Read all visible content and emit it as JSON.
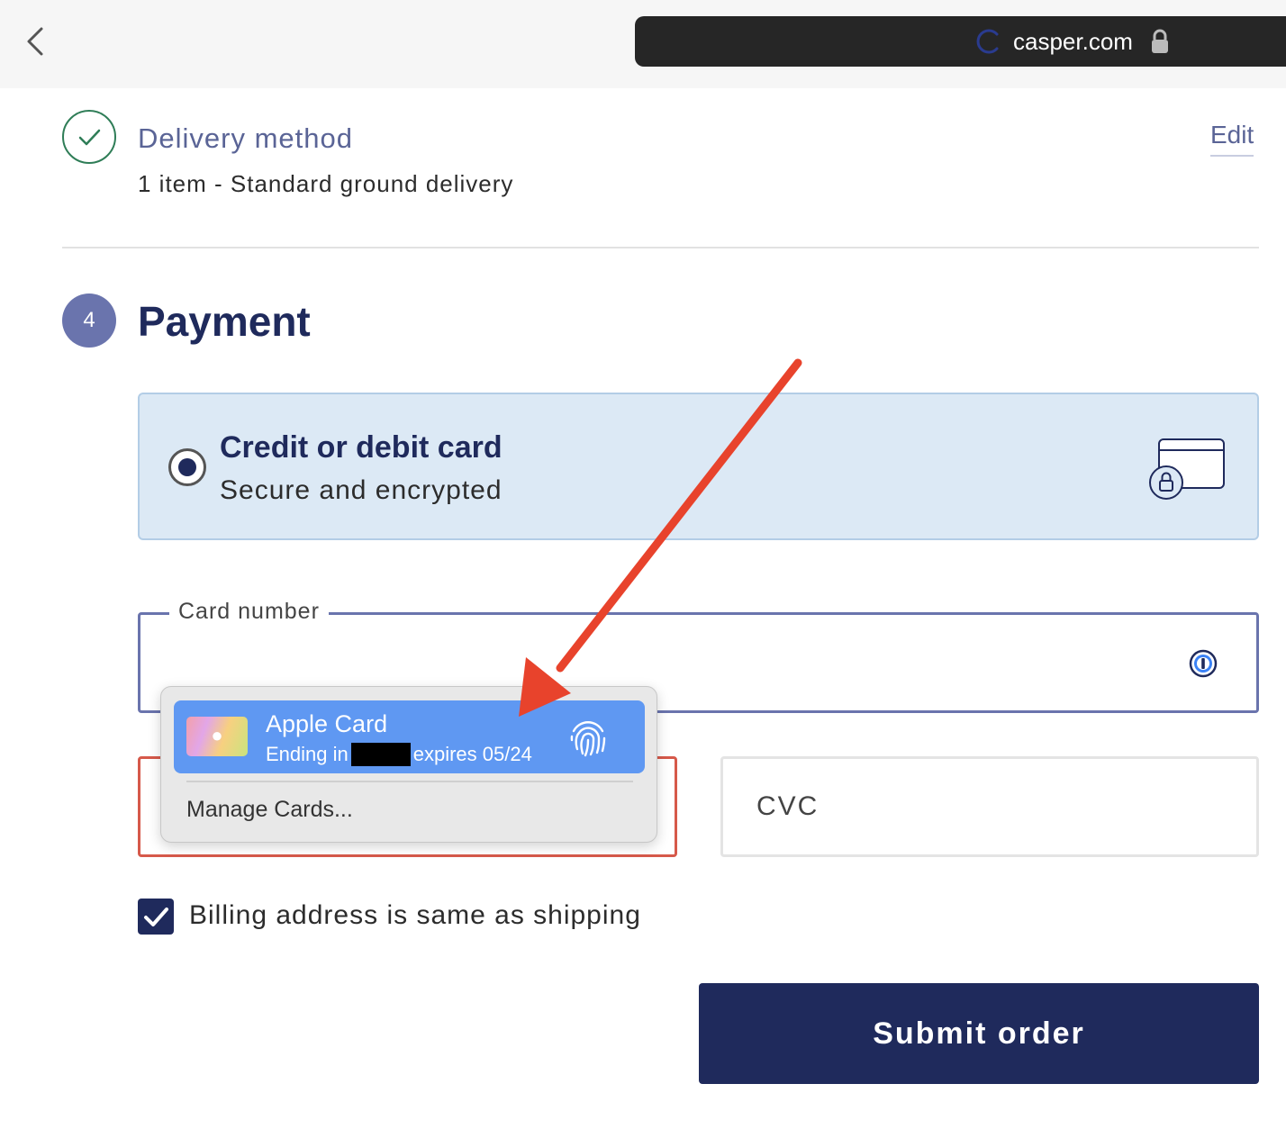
{
  "browser": {
    "url": "casper.com"
  },
  "delivery": {
    "title": "Delivery method",
    "summary": "1 item - Standard ground delivery",
    "edit_label": "Edit"
  },
  "payment": {
    "step_number": "4",
    "title": "Payment",
    "method": {
      "title": "Credit or debit card",
      "subtitle": "Secure and encrypted",
      "selected": true
    },
    "card_number_label": "Card number",
    "cvc_placeholder": "CVC",
    "billing_same_label": "Billing address is same as shipping",
    "billing_same_checked": true,
    "submit_label": "Submit order"
  },
  "autofill": {
    "card_name": "Apple Card",
    "ending_prefix": "Ending in",
    "expires_text": "expires 05/24",
    "manage_label": "Manage Cards..."
  },
  "colors": {
    "navy": "#1f2a5c",
    "accent_purple": "#6a74ad",
    "error_red": "#d6594a",
    "annotation_arrow": "#e8432c",
    "highlight_blue": "#5f98f2"
  }
}
